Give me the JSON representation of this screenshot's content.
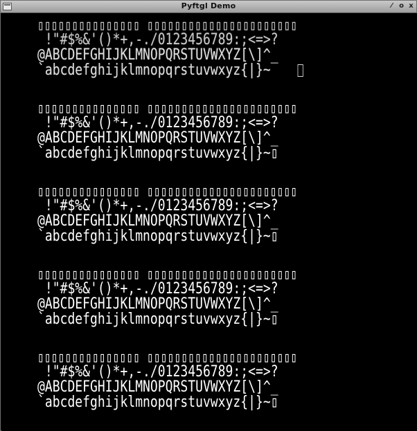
{
  "window": {
    "title": "Pyftgl Demo",
    "controls": {
      "minimize": "⁄",
      "maximize": "o",
      "close": "x"
    }
  },
  "blocks": [
    {
      "line0": "▯▯▯▯▯▯▯▯▯▯▯▯▯▯▯ ▯▯▯▯▯▯▯▯▯▯▯▯▯▯▯▯▯▯▯▯▯▯",
      "line1": " !\"#$%&'()*+,-./0123456789:;<=>?",
      "line2": "@ABCDEFGHIJKLMNOPQRSTUVWXYZ[\\]^_",
      "line3": "`abcdefghijklmnopqrstuvwxyz{|}~"
    },
    {
      "line0": "▯▯▯▯▯▯▯▯▯▯▯▯▯▯▯ ▯▯▯▯▯▯▯▯▯▯▯▯▯▯▯▯▯▯▯▯▯▯",
      "line1": " !\"#$%&'()*+,-./0123456789:;<=>?",
      "line2": "@ABCDEFGHIJKLMNOPQRSTUVWXYZ[\\]^_",
      "line3": "`abcdefghijklmnopqrstuvwxyz{|}~▯"
    },
    {
      "line0": "▯▯▯▯▯▯▯▯▯▯▯▯▯▯▯ ▯▯▯▯▯▯▯▯▯▯▯▯▯▯▯▯▯▯▯▯▯▯",
      "line1": " !\"#$%&'()*+,-./0123456789:;<=>?",
      "line2": "@ABCDEFGHIJKLMNOPQRSTUVWXYZ[\\]^_",
      "line3": "`abcdefghijklmnopqrstuvwxyz{|}~▯"
    },
    {
      "line0": "▯▯▯▯▯▯▯▯▯▯▯▯▯▯▯ ▯▯▯▯▯▯▯▯▯▯▯▯▯▯▯▯▯▯▯▯▯▯",
      "line1": " !\"#$%&'()*+,-./0123456789:;<=>?",
      "line2": "@ABCDEFGHIJKLMNOPQRSTUVWXYZ[\\]^_",
      "line3": "`abcdefghijklmnopqrstuvwxyz{|}~▯"
    },
    {
      "line0": "▯▯▯▯▯▯▯▯▯▯▯▯▯▯▯ ▯▯▯▯▯▯▯▯▯▯▯▯▯▯▯▯▯▯▯▯▯▯",
      "line1": " !\"#$%&'()*+,-./0123456789:;<=>?",
      "line2": "@ABCDEFGHIJKLMNOPQRSTUVWXYZ[\\]^_",
      "line3": "`abcdefghijklmnopqrstuvwxyz{|}~▯"
    }
  ]
}
